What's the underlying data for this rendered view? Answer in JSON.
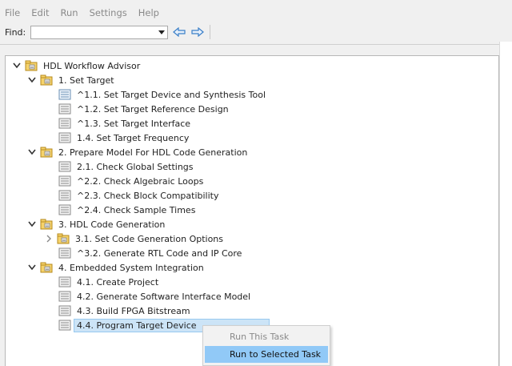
{
  "menubar": {
    "items": [
      "File",
      "Edit",
      "Run",
      "Settings",
      "Help"
    ]
  },
  "toolbar": {
    "find_label": "Find:",
    "find_value": ""
  },
  "tree": {
    "root": "HDL Workflow Advisor",
    "items": [
      "1. Set Target",
      "^1.1. Set Target Device and Synthesis Tool",
      "^1.2. Set Target Reference Design",
      "^1.3. Set Target Interface",
      "1.4. Set Target Frequency",
      "2. Prepare Model For HDL Code Generation",
      "2.1. Check Global Settings",
      "^2.2. Check Algebraic Loops",
      "^2.3. Check Block Compatibility",
      "^2.4. Check Sample Times",
      "3. HDL Code Generation",
      "3.1. Set Code Generation Options",
      "^3.2. Generate RTL Code and IP Core",
      "4. Embedded System Integration",
      "4.1. Create Project",
      "4.2. Generate Software Interface Model",
      "4.3. Build FPGA Bitstream",
      "4.4. Program Target Device"
    ]
  },
  "context_menu": {
    "items": [
      "Run This Task",
      "Run to Selected Task"
    ]
  },
  "colors": {
    "selection": "#cce4f7",
    "menu_hover": "#91c9f7",
    "arrow_blue": "#3a7fc8"
  }
}
